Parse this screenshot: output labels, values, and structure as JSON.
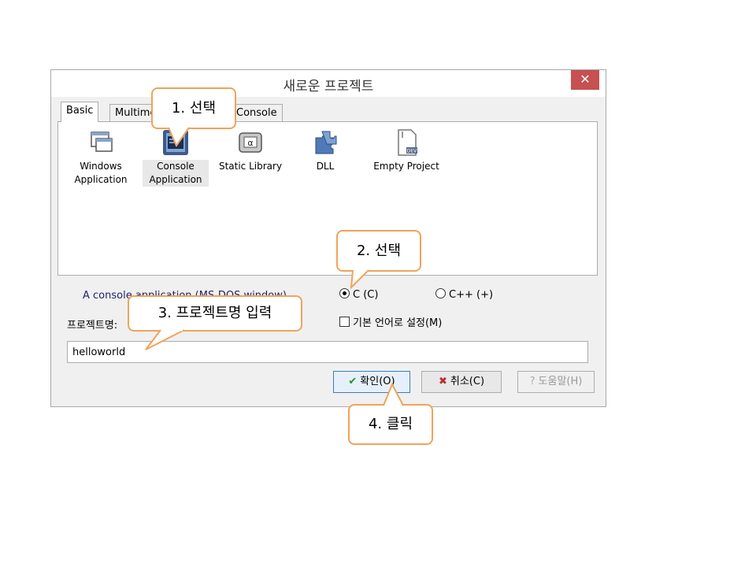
{
  "dialog": {
    "title": "새로운 프로젝트",
    "close": "✕"
  },
  "tabs": [
    {
      "label": "Basic"
    },
    {
      "label": "Multimedia"
    },
    {
      "label": "Console"
    }
  ],
  "projects": [
    {
      "label_line1": "Windows",
      "label_line2": "Application",
      "icon": "window-icon"
    },
    {
      "label_line1": "Console",
      "label_line2": "Application",
      "icon": "console-icon"
    },
    {
      "label_line1": "Static Library",
      "label_line2": "",
      "icon": "library-icon"
    },
    {
      "label_line1": "DLL",
      "label_line2": "",
      "icon": "dll-icon"
    },
    {
      "label_line1": "Empty Project",
      "label_line2": "",
      "icon": "empty-project-icon"
    }
  ],
  "description": "A console application (MS-DOS window)",
  "language": {
    "c_label": "C (C)",
    "cpp_label": "C++ (+)",
    "selected": "C"
  },
  "default_lang": {
    "label": "기본 언어로 설정(M)"
  },
  "project_name": {
    "label": "프로젝트명:",
    "value": "helloworld"
  },
  "buttons": {
    "ok": "확인(O)",
    "cancel": "취소(C)",
    "help": "도움말(H)"
  },
  "callouts": {
    "c1": "1. 선택",
    "c2": "2. 선택",
    "c3": "3. 프로젝트명  입력",
    "c4": "4. 클릭"
  },
  "colors": {
    "callout_border": "#f0a35a",
    "close_button": "#c75050"
  }
}
